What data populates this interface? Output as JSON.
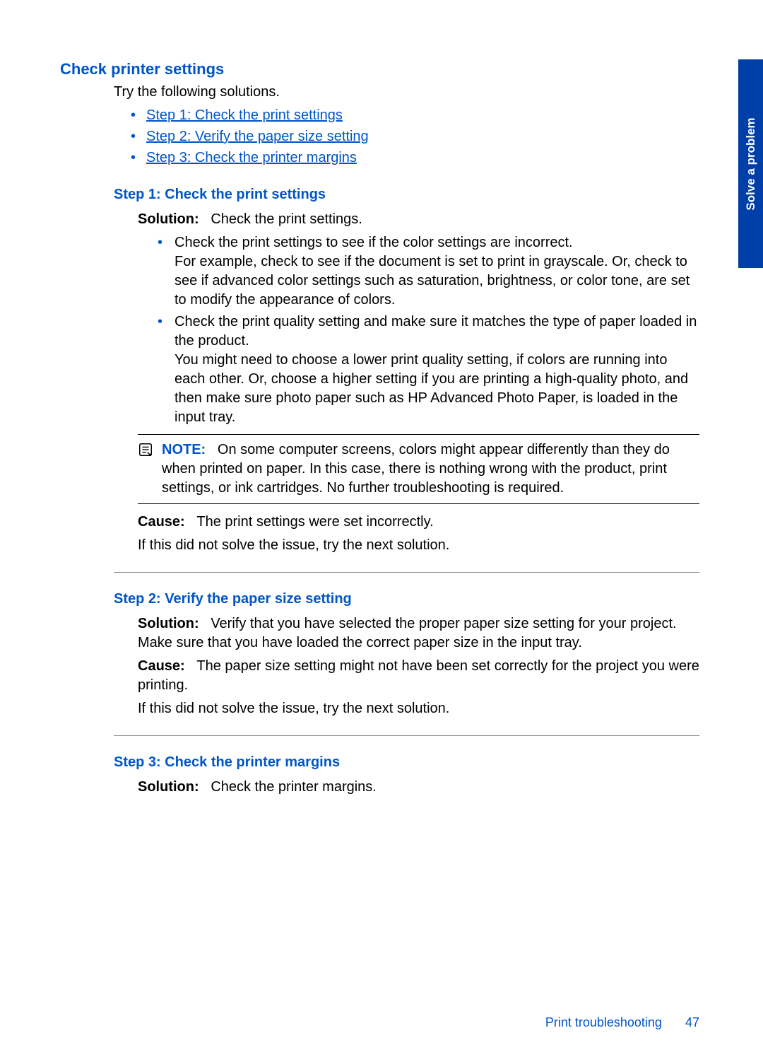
{
  "sideTab": "Solve a problem",
  "title": "Check printer settings",
  "intro": "Try the following solutions.",
  "toc": [
    "Step 1: Check the print settings",
    "Step 2: Verify the paper size setting",
    "Step 3: Check the printer margins"
  ],
  "step1": {
    "heading": "Step 1: Check the print settings",
    "solutionLabel": "Solution:",
    "solutionText": "Check the print settings.",
    "bullet1a": "Check the print settings to see if the color settings are incorrect.",
    "bullet1b": "For example, check to see if the document is set to print in grayscale. Or, check to see if advanced color settings such as saturation, brightness, or color tone, are set to modify the appearance of colors.",
    "bullet2a": "Check the print quality setting and make sure it matches the type of paper loaded in the product.",
    "bullet2b": "You might need to choose a lower print quality setting, if colors are running into each other. Or, choose a higher setting if you are printing a high-quality photo, and then make sure photo paper such as HP Advanced Photo Paper, is loaded in the input tray.",
    "noteLabel": "NOTE:",
    "noteText": "On some computer screens, colors might appear differently than they do when printed on paper. In this case, there is nothing wrong with the product, print settings, or ink cartridges. No further troubleshooting is required.",
    "causeLabel": "Cause:",
    "causeText": "The print settings were set incorrectly.",
    "next": "If this did not solve the issue, try the next solution."
  },
  "step2": {
    "heading": "Step 2: Verify the paper size setting",
    "solutionLabel": "Solution:",
    "solutionText": "Verify that you have selected the proper paper size setting for your project. Make sure that you have loaded the correct paper size in the input tray.",
    "causeLabel": "Cause:",
    "causeText": "The paper size setting might not have been set correctly for the project you were printing.",
    "next": "If this did not solve the issue, try the next solution."
  },
  "step3": {
    "heading": "Step 3: Check the printer margins",
    "solutionLabel": "Solution:",
    "solutionText": "Check the printer margins."
  },
  "footer": {
    "text": "Print troubleshooting",
    "page": "47"
  }
}
